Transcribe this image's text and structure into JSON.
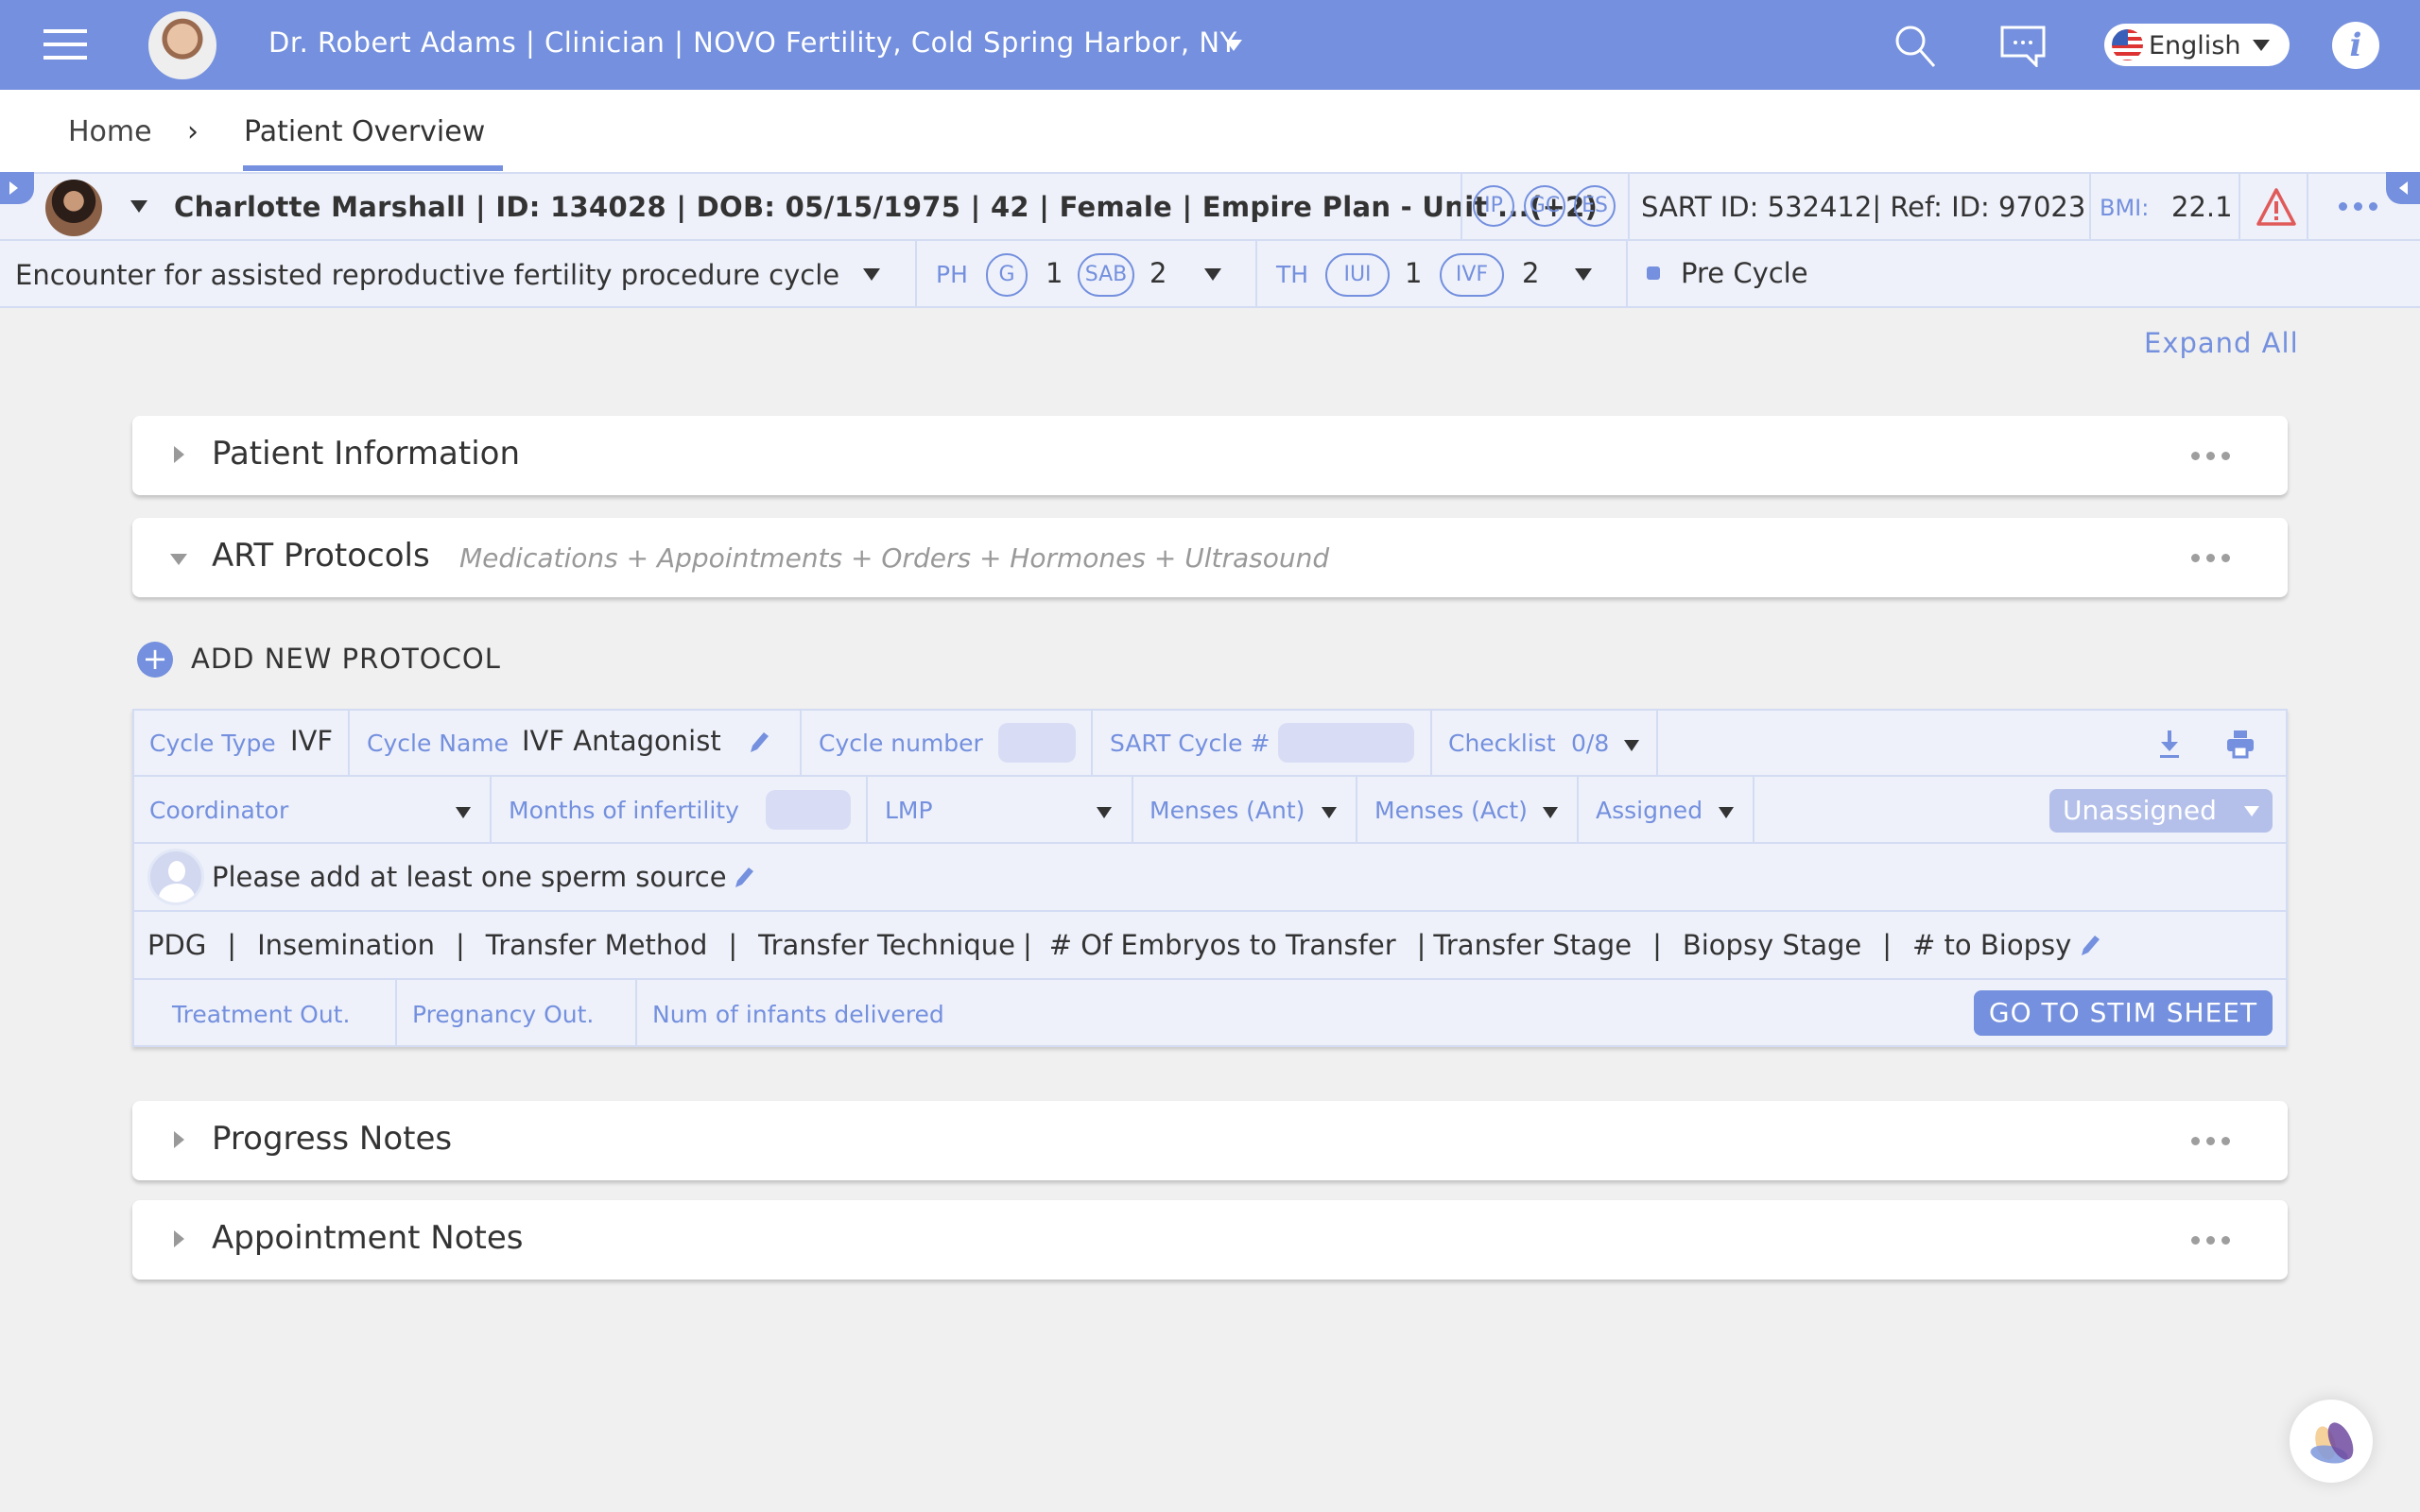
{
  "header": {
    "user_title": "Dr. Robert Adams | Clinician | NOVO Fertility, Cold Spring Harbor, NY",
    "language": "English",
    "brand_color": "#7490de"
  },
  "breadcrumb": {
    "home": "Home",
    "separator": "›",
    "current": "Patient Overview"
  },
  "patient": {
    "summary": "Charlotte Marshall | ID: 134028 | DOB: 05/15/1975 | 42 | Female | Empire Plan - Unit ...(+2)",
    "badges": [
      "IP",
      "GC",
      "ES"
    ],
    "ids": "SART ID: 532412| Ref: ID: 97023",
    "bmi_label": "BMI:",
    "bmi_value": "22.1",
    "alert_color": "#e05a5a"
  },
  "encounter": {
    "label": "Encounter for assisted reproductive fertility procedure cycle",
    "ph": {
      "label": "PH",
      "items": [
        {
          "badge": "G",
          "count": "1"
        },
        {
          "badge": "SAB",
          "count": "2"
        }
      ]
    },
    "th": {
      "label": "TH",
      "items": [
        {
          "badge": "IUI",
          "count": "1"
        },
        {
          "badge": "IVF",
          "count": "2"
        }
      ]
    },
    "status": "Pre Cycle"
  },
  "main": {
    "expand_all": "Expand All",
    "sections": [
      {
        "title": "Patient Information",
        "expanded": false
      },
      {
        "title": "ART Protocols",
        "subtitle": "Medications + Appointments + Orders + Hormones + Ultrasound",
        "expanded": true
      },
      {
        "title": "Progress Notes",
        "expanded": false
      },
      {
        "title": "Appointment Notes",
        "expanded": false
      }
    ],
    "add_protocol": "ADD NEW PROTOCOL"
  },
  "protocol": {
    "cycle_type_label": "Cycle Type",
    "cycle_type_value": "IVF",
    "cycle_name_label": "Cycle Name",
    "cycle_name_value": "IVF Antagonist",
    "cycle_number_label": "Cycle number",
    "cycle_number_value": "",
    "sart_cycle_label": "SART Cycle #",
    "sart_cycle_value": "",
    "checklist_label": "Checklist",
    "checklist_value": "0/8",
    "coordinator_label": "Coordinator",
    "months_infertility_label": "Months of infertility",
    "months_infertility_value": "",
    "lmp_label": "LMP",
    "menses_ant_label": "Menses (Ant)",
    "menses_act_label": "Menses (Act)",
    "assigned_label": "Assigned",
    "assigned_value": "Unassigned",
    "sperm_source": "Please add at least one sperm source",
    "fields_line": [
      "PDG",
      "Insemination",
      "Transfer Method",
      "Transfer Technique",
      "# Of Embryos to Transfer",
      "Transfer Stage",
      "Biopsy Stage",
      "# to Biopsy"
    ],
    "treatment_out": "Treatment Out.",
    "pregnancy_out": "Pregnancy Out.",
    "num_infants": "Num of infants delivered",
    "stim_button": "GO TO STIM SHEET"
  }
}
